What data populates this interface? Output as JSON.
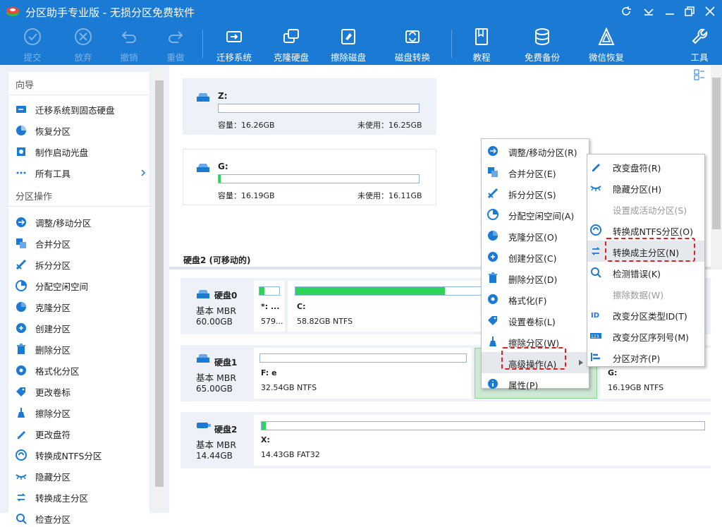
{
  "window": {
    "title": "分区助手专业版 - 无损分区免费软件"
  },
  "toolbar": {
    "commit": "提交",
    "discard": "放弃",
    "undo": "撤销",
    "redo": "重做",
    "migrate": "迁移系统",
    "clone": "克隆硬盘",
    "wipe": "擦除磁盘",
    "convert": "磁盘转换",
    "tutorial": "教程",
    "backup": "免费备份",
    "wechat": "微信恢复",
    "tools": "工具"
  },
  "sidebar": {
    "wizard_title": "向导",
    "wizard_items": [
      "迁移系统到固态硬盘",
      "恢复分区",
      "制作启动光盘",
      "所有工具"
    ],
    "ops_title": "分区操作",
    "ops_items": [
      "调整/移动分区",
      "合并分区",
      "拆分分区",
      "分配空闲空间",
      "克隆分区",
      "创建分区",
      "删除分区",
      "格式化分区",
      "更改卷标",
      "擦除分区",
      "更改盘符",
      "转换成NTFS分区",
      "隐藏分区",
      "转换成主分区",
      "检查分区"
    ]
  },
  "partitions": {
    "z": {
      "name": "Z:",
      "cap": "容量：16.26GB",
      "free": "未使用：16.25GB"
    },
    "g": {
      "name": "G:",
      "cap": "容量：16.19GB",
      "free": "未使用：16.11GB"
    }
  },
  "disk_section_title": "硬盘2 (可移动的)",
  "disks": [
    {
      "name": "硬盘0",
      "type": "基本 MBR",
      "size": "60.00GB",
      "parts": [
        {
          "label": "*: ...",
          "info": "579..."
        },
        {
          "label": "C:",
          "info": "58.82GB NTFS"
        }
      ]
    },
    {
      "name": "硬盘1",
      "type": "基本 MBR",
      "size": "65.00GB",
      "parts": [
        {
          "label": "F: e",
          "info": "32.54GB NTFS"
        },
        {
          "label": "G:",
          "info": "16.19GB NTFS"
        }
      ]
    },
    {
      "name": "硬盘2",
      "type": "基本 MBR",
      "size": "14.44GB",
      "parts": [
        {
          "label": "X:",
          "info": "14.43GB FAT32"
        }
      ]
    }
  ],
  "context_menu": [
    "调整/移动分区(R)",
    "合并分区(E)",
    "拆分分区(S)",
    "分配空闲空间(A)",
    "克隆分区(O)",
    "创建分区(C)",
    "删除分区(D)",
    "格式化(F)",
    "设置卷标(L)",
    "擦除分区(W)",
    "高级操作(A)",
    "属性(P)"
  ],
  "submenu": [
    "改变盘符(R)",
    "隐藏分区(H)",
    "设置成活动分区(S)",
    "转换成NTFS分区(O)",
    "转换成主分区(N)",
    "检测错误(K)",
    "擦除数据(W)",
    "改变分区类型ID(T)",
    "改变分区序列号(M)",
    "分区对齐(P)"
  ],
  "colors": {
    "accent": "#1b7ad4",
    "used": "#2fd35a",
    "highlight": "#e02020"
  }
}
